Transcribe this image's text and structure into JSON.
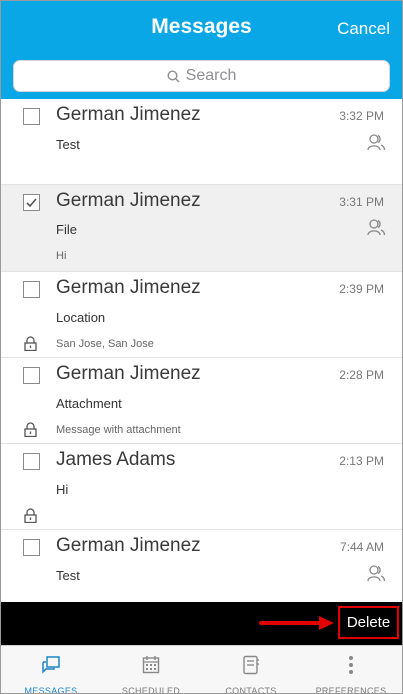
{
  "header": {
    "title": "Messages",
    "cancel_label": "Cancel"
  },
  "search": {
    "placeholder": "Search"
  },
  "messages": [
    {
      "name": "German Jimenez",
      "time": "3:32 PM",
      "subject": "Test",
      "preview": "",
      "checked": false,
      "group": true,
      "locked": false
    },
    {
      "name": "German Jimenez",
      "time": "3:31 PM",
      "subject": "File",
      "preview": "Hi",
      "checked": true,
      "group": true,
      "locked": false
    },
    {
      "name": "German Jimenez",
      "time": "2:39 PM",
      "subject": "Location",
      "preview": "San Jose, San Jose",
      "checked": false,
      "group": false,
      "locked": true
    },
    {
      "name": "German Jimenez",
      "time": "2:28 PM",
      "subject": "Attachment",
      "preview": "Message with attachment",
      "checked": false,
      "group": false,
      "locked": true
    },
    {
      "name": "James Adams",
      "time": "2:13 PM",
      "subject": "Hi",
      "preview": "",
      "checked": false,
      "group": false,
      "locked": true
    },
    {
      "name": "German Jimenez",
      "time": "7:44 AM",
      "subject": "Test",
      "preview": "",
      "checked": false,
      "group": true,
      "locked": false
    }
  ],
  "action_bar": {
    "delete_label": "Delete"
  },
  "tabs": [
    {
      "label": "MESSAGES",
      "icon": "messages-icon",
      "active": true
    },
    {
      "label": "SCHEDULED",
      "icon": "calendar-icon",
      "active": false
    },
    {
      "label": "CONTACTS",
      "icon": "contacts-icon",
      "active": false
    },
    {
      "label": "PREFERENCES",
      "icon": "more-icon",
      "active": false
    }
  ],
  "colors": {
    "accent": "#0aa7e6",
    "delete_highlight": "#e00000",
    "tab_active": "#1c86c8"
  }
}
